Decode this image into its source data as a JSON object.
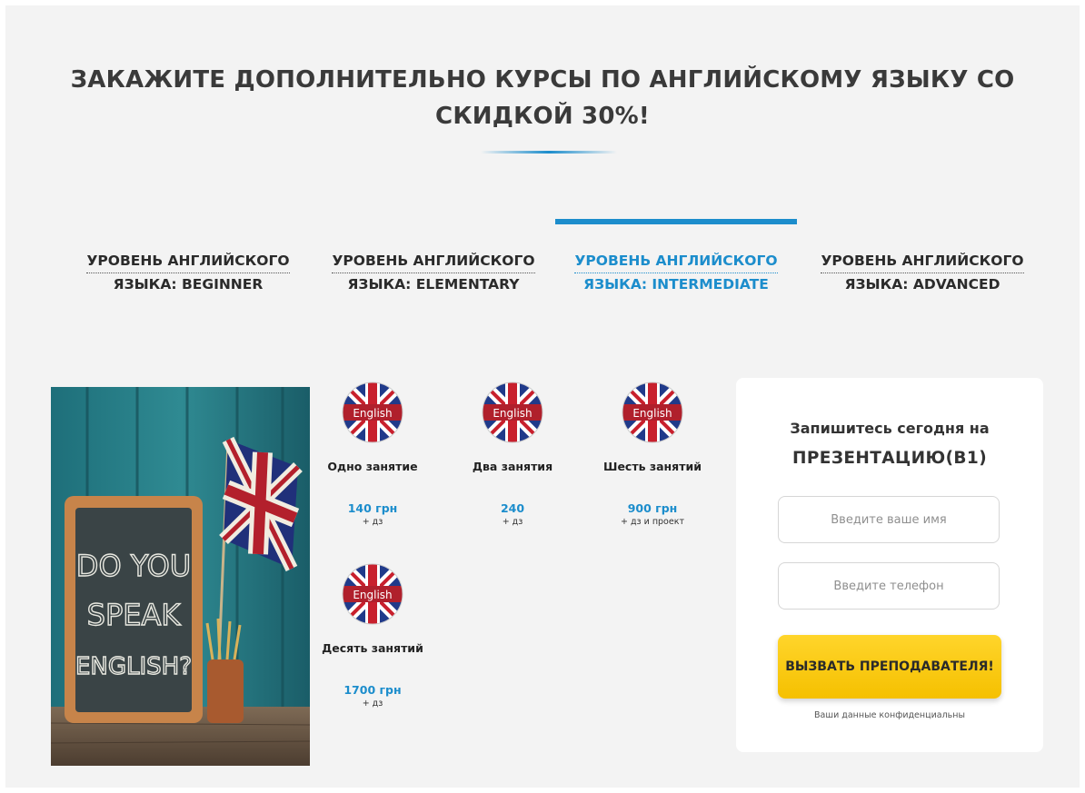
{
  "header": {
    "title_line1": "ЗАКАЖИТЕ ДОПОЛНИТЕЛЬНО КУРСЫ ПО АНГЛИЙСКОМУ ЯЗЫКУ СО",
    "title_line2": "СКИДКОЙ 30%!"
  },
  "tabs": [
    {
      "line1": "УРОВЕНЬ АНГЛИЙСКОГО",
      "line2": "ЯЗЫКА: BEGINNER",
      "active": false
    },
    {
      "line1": "УРОВЕНЬ АНГЛИЙСКОГО",
      "line2": "ЯЗЫКА: ELEMENTARY",
      "active": false
    },
    {
      "line1": "УРОВЕНЬ АНГЛИЙСКОГО",
      "line2": "ЯЗЫКА: INTERMEDIATE",
      "active": true
    },
    {
      "line1": "УРОВЕНЬ АНГЛИЙСКОГО",
      "line2": "ЯЗЫКА: ADVANCED",
      "active": false
    }
  ],
  "photo": {
    "chalkboard_lines": [
      "DO YOU",
      "SPEAK",
      "ENGLISH?"
    ]
  },
  "courses": [
    {
      "name": "Одно занятие",
      "price": "140 грн",
      "note": "+ дз",
      "flag_label": "English"
    },
    {
      "name": "Два занятия",
      "price": "240",
      "note": "+ дз",
      "flag_label": "English"
    },
    {
      "name": "Шесть занятий",
      "price": "900 грн",
      "note": "+ дз и проект",
      "flag_label": "English"
    },
    {
      "name": "Десять занятий",
      "price": "1700 грн",
      "note": "+ дз",
      "flag_label": "English"
    }
  ],
  "form": {
    "heading": "Запишитесь сегодня на",
    "subheading": "ПРЕЗЕНТАЦИЮ(B1)",
    "name_placeholder": "Введите ваше имя",
    "phone_placeholder": "Введите телефон",
    "submit_label": "ВЫЗВАТЬ ПРЕПОДАВАТЕЛЯ!",
    "privacy_note": "Ваши данные конфиденциальны"
  },
  "colors": {
    "accent": "#1c8dcc",
    "cta": "#f7c600",
    "background": "#f3f3f3"
  },
  "icons": {
    "flag": "uk-flag-icon"
  }
}
